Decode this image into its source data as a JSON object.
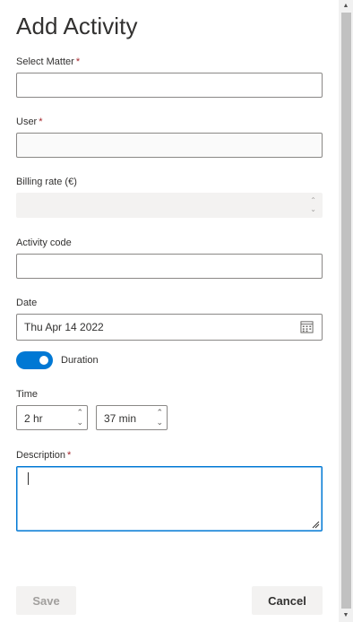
{
  "title": "Add Activity",
  "fields": {
    "matter": {
      "label": "Select Matter",
      "required_mark": "*",
      "value": ""
    },
    "user": {
      "label": "User",
      "required_mark": "*",
      "value": ""
    },
    "billing_rate": {
      "label": "Billing rate (€)",
      "value": ""
    },
    "activity_code": {
      "label": "Activity code",
      "value": ""
    },
    "date": {
      "label": "Date",
      "value": "Thu Apr 14 2022",
      "icon": "calendar-icon"
    },
    "duration_toggle": {
      "label": "Duration",
      "on": true
    },
    "time": {
      "label": "Time",
      "hours": "2 hr",
      "minutes": "37 min"
    },
    "description": {
      "label": "Description",
      "required_mark": "*",
      "value": ""
    }
  },
  "actions": {
    "save": "Save",
    "cancel": "Cancel"
  },
  "colors": {
    "accent": "#0078d4",
    "required": "#a4262c"
  }
}
